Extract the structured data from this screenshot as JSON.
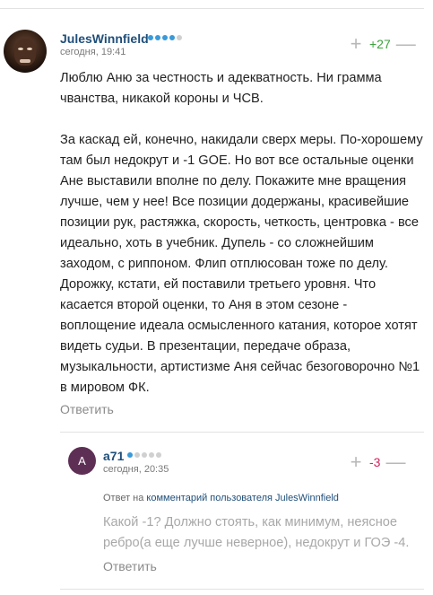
{
  "main_comment": {
    "author": "JulesWinnfield",
    "rating_dots": [
      true,
      true,
      true,
      true,
      false
    ],
    "time": "сегодня, 19:41",
    "score": "+27",
    "plus": "+",
    "minus": "—",
    "avatar": "user-photo-avatar",
    "paragraphs": [
      "Люблю Аню за честность и адекватность. Ни грамма чванства, никакой короны и ЧСВ.",
      "За каскад ей, конечно, накидали сверх меры. По-хорошему там был недокрут и -1 GOE. Но вот все остальные оценки Ане выставили вполне по делу. Покажите мне вращения лучше, чем у нее! Все позиции додержаны, красивейшие позиции рук, растяжка, скорость, четкость, центровка - все идеально, хоть в учебник. Дупель - со сложнейшим заходом, с риппоном. Флип отплюсован тоже по делу. Дорожку, кстати, ей поставили третьего уровня. Что касается второй оценки, то Аня в этом сезоне - воплощение идеала осмысленного катания, которое хотят видеть судьи. В презентации, передаче образа, музыкальности, артистизме Аня сейчас безоговорочно №1 в мировом ФК."
    ],
    "reply_label": "Ответить"
  },
  "reply_comment": {
    "avatar_letter": "А",
    "author": "a71",
    "rating_dots": [
      true,
      false,
      false,
      false,
      false
    ],
    "time": "сегодня, 20:35",
    "score": "-3",
    "plus": "+",
    "minus": "—",
    "answer_prefix": "Ответ на",
    "answer_link": "комментарий пользователя JulesWinnfield",
    "text": "Какой -1? Должно стоять, как минимум, неясное ребро(а еще лучше неверное), недокрут и ГОЭ -4.",
    "reply_label": "Ответить"
  },
  "colors": {
    "author": "#1f4f7a",
    "positive_score": "#3ca23c",
    "negative_score": "#d0245c",
    "rating_dot_on": "#3a9ad9"
  }
}
